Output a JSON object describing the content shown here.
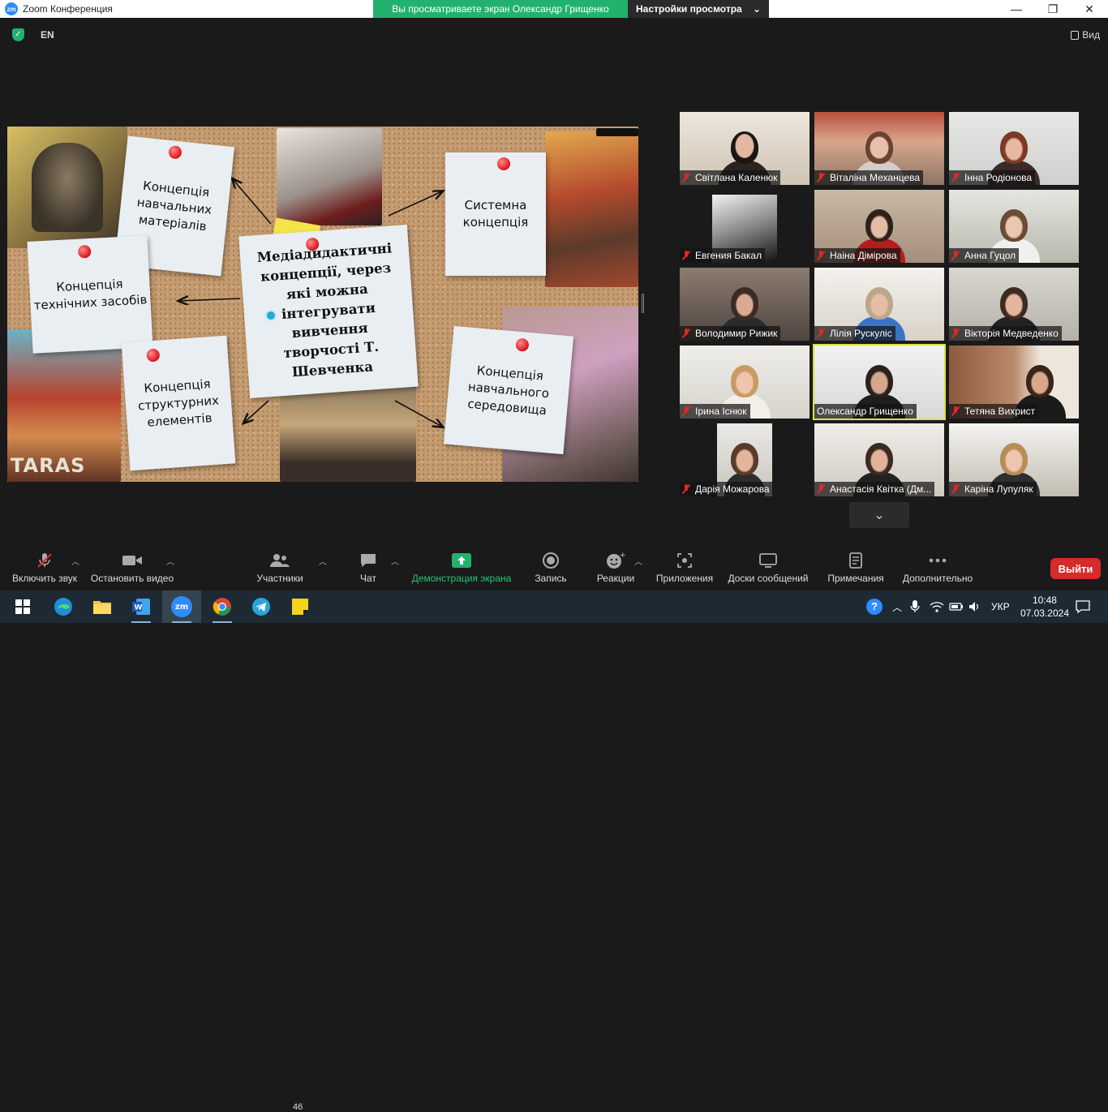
{
  "window": {
    "title": "Zoom Конференция",
    "app_logo": "zm"
  },
  "share_banner": {
    "viewing_text": "Вы просматриваете экран Олександр Грищенко",
    "view_options_label": "Настройки просмотра"
  },
  "topbar": {
    "language": "EN",
    "view_label": "Вид"
  },
  "slide": {
    "center_note": "Медіадидактичні концепції, через які можна інтегрувати вивчення творчості Т. Шевченка",
    "notes": [
      "Концепція навчальних матеріалів",
      "Системна концепція",
      "Концепція технічних засобів",
      "Концепція структурних елементів",
      "Концепція навчального середовища"
    ],
    "taras_text": "TARAS"
  },
  "participants": [
    {
      "name": "Світлана Каленюк",
      "muted": true
    },
    {
      "name": "Віталіна Механцева",
      "muted": true
    },
    {
      "name": "Інна Родіонова",
      "muted": true
    },
    {
      "name": "Евгения Бакал",
      "muted": true
    },
    {
      "name": "Наіна Дімірова",
      "muted": true
    },
    {
      "name": "Анна Гуцол",
      "muted": true
    },
    {
      "name": "Володимир Рижик",
      "muted": true
    },
    {
      "name": "Лілія Рускуліс",
      "muted": true
    },
    {
      "name": "Вікторія Медведенко",
      "muted": true
    },
    {
      "name": "Ірина Існюк",
      "muted": true
    },
    {
      "name": "Олександр Грищенко",
      "muted": false
    },
    {
      "name": "Тетяна Вихрист",
      "muted": true
    },
    {
      "name": "Дарія Можарова",
      "muted": true
    },
    {
      "name": "Анастасія Квітка (Дм...",
      "muted": true
    },
    {
      "name": "Каріна Лупуляк",
      "muted": true
    }
  ],
  "toolbar": {
    "unmute": "Включить звук",
    "video": "Остановить видео",
    "participants": "Участники",
    "participants_count": "46",
    "chat": "Чат",
    "share": "Демонстрация экрана",
    "record": "Запись",
    "reactions": "Реакции",
    "apps": "Приложения",
    "whiteboards": "Доски сообщений",
    "notes": "Примечания",
    "more": "Дополнительно",
    "leave": "Выйти"
  },
  "taskbar": {
    "language": "УКР",
    "time": "10:48",
    "date": "07.03.2024"
  },
  "colors": {
    "share_green": "#23b26d",
    "leave_red": "#d62b2b",
    "active_speaker": "#d6e33b"
  }
}
